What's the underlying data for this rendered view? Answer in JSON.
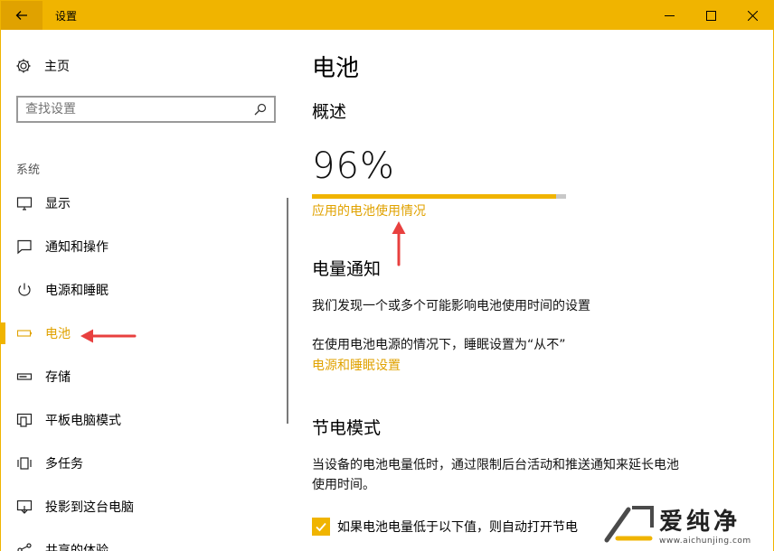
{
  "window": {
    "title": "设置",
    "accent": "#f0b400"
  },
  "sidebar": {
    "home_label": "主页",
    "search_placeholder": "查找设置",
    "group_label": "系统",
    "items": [
      {
        "label": "显示",
        "icon": "monitor-icon"
      },
      {
        "label": "通知和操作",
        "icon": "message-icon"
      },
      {
        "label": "电源和睡眠",
        "icon": "power-icon"
      },
      {
        "label": "电池",
        "icon": "battery-icon",
        "active": true
      },
      {
        "label": "存储",
        "icon": "storage-icon"
      },
      {
        "label": "平板电脑模式",
        "icon": "tablet-icon"
      },
      {
        "label": "多任务",
        "icon": "multitask-icon"
      },
      {
        "label": "投影到这台电脑",
        "icon": "project-icon"
      },
      {
        "label": "共享的体验",
        "icon": "share-icon"
      }
    ]
  },
  "content": {
    "page_title": "电池",
    "overview_heading": "概述",
    "battery_percent_text": "96%",
    "battery_level": 0.96,
    "usage_link": "应用的电池使用情况",
    "notify_heading": "电量通知",
    "notify_text": "我们发现一个或多个可能影响电池使用时间的设置",
    "sleep_text": "在使用电池电源的情况下，睡眠设置为“从不”",
    "sleep_link": "电源和睡眠设置",
    "saver_heading": "节电模式",
    "saver_text_line1": "当设备的电池电量低时，通过限制后台活动和推送通知来延长电池",
    "saver_text_line2": "使用时间。",
    "saver_checkbox": "如果电池电量低于以下值，则自动打开节电"
  },
  "watermark": {
    "brand": "爱纯净",
    "url": "www.aichunjing.com"
  }
}
